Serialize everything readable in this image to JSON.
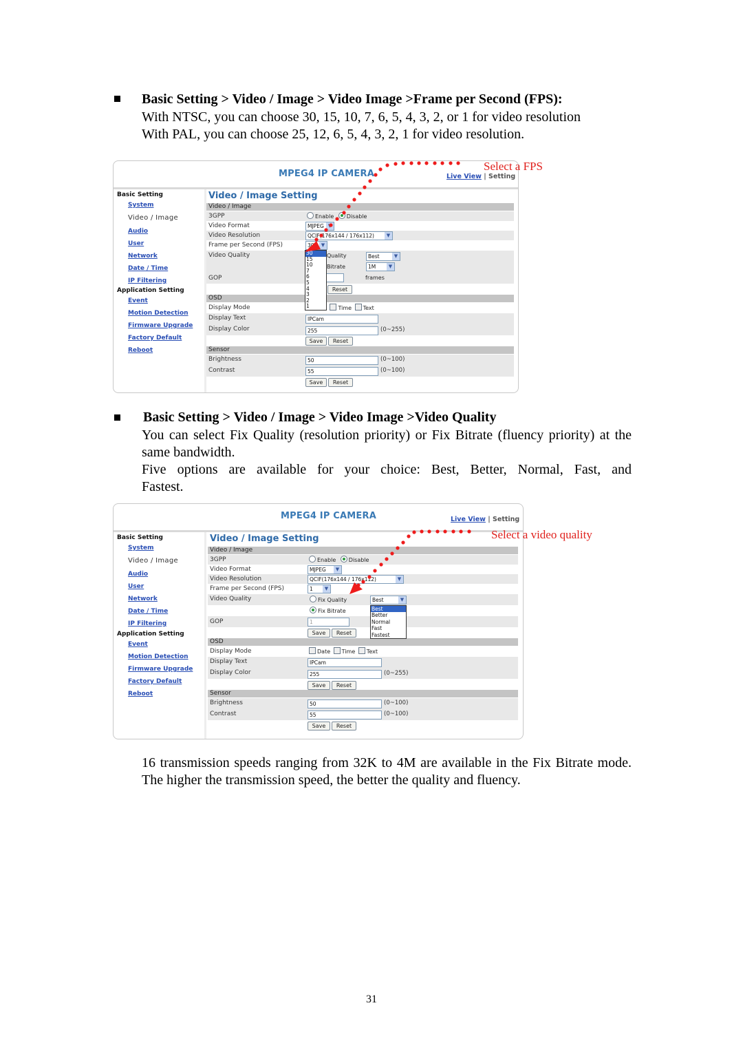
{
  "section1": {
    "heading": "Basic Setting > Video / Image > Video Image >Frame per Second (FPS):",
    "lines": [
      "With NTSC, you can choose 30, 15, 10, 7, 6, 5, 4, 3, 2, or 1 for video resolution",
      "With PAL, you can choose 25, 12, 6, 5, 4, 3, 2, 1 for video resolution."
    ],
    "annotation": "Select a FPS"
  },
  "section2": {
    "heading": "Basic Setting > Video / Image > Video Image >Video Quality",
    "paragraphs": [
      "You can select Fix Quality (resolution priority) or Fix Bitrate (fluency priority) at the same bandwidth.",
      "Five options are available for your choice: Best, Better, Normal, Fast, and Fastest."
    ],
    "annotation": "Select a video quality"
  },
  "section3": {
    "paragraph": "16 transmission speeds ranging from 32K to 4M are available in the Fix Bitrate mode. The higher the transmission speed, the better the quality and fluency."
  },
  "page_number": "31",
  "camera_ui": {
    "brand": "MPEG4 IP CAMERA",
    "nav_live_view": "Live View",
    "nav_sep": "|",
    "nav_setting": "Setting",
    "sidebar": {
      "basic_group": "Basic Setting",
      "basic_items": [
        "System",
        "Video / Image",
        "Audio",
        "User",
        "Network",
        "Date / Time",
        "IP Filtering"
      ],
      "app_group": "Application Setting",
      "app_items": [
        "Event",
        "Motion Detection",
        "Firmware Upgrade",
        "Factory Default",
        "Reboot"
      ]
    },
    "page_title": "Video / Image Setting",
    "labels": {
      "sec_video": "Video / Image",
      "gpp": "3GPP",
      "format": "Video Format",
      "resolution": "Video Resolution",
      "fps": "Frame per Second (FPS)",
      "quality": "Video Quality",
      "gop": "GOP",
      "sec_osd": "OSD",
      "display_mode": "Display Mode",
      "display_text": "Display Text",
      "display_color": "Display Color",
      "sec_sensor": "Sensor",
      "brightness": "Brightness",
      "contrast": "Contrast"
    },
    "enable": "Enable",
    "disable": "Disable",
    "format_value": "MJPEG",
    "resolution_value": "QCIF(176x144 / 176x112)",
    "fix_quality": "Fix Quality",
    "fix_bitrate": "Fix Bitrate",
    "frames": "frames",
    "date": "Date",
    "time": "Time",
    "text": "Text",
    "display_text_value": "IPCam",
    "display_color_value": "255",
    "color_range": "(0~255)",
    "brightness_value": "50",
    "contrast_value": "55",
    "sensor_range": "(0~100)",
    "save": "Save",
    "reset": "Reset"
  },
  "screenshot1": {
    "quality_partial": "Quality",
    "bitrate_partial": "Bitrate",
    "quality_select": "Best",
    "bitrate_select": "1M",
    "fps_options": [
      "30",
      "15",
      "10",
      "7",
      "6",
      "5",
      "4",
      "3",
      "2",
      "1"
    ],
    "fps_highlighted": "30",
    "mode_partial": "e"
  },
  "screenshot2": {
    "fps_value": "1",
    "quality_select": "Best",
    "quality_options": [
      "Best",
      "Better",
      "Normal",
      "Fast",
      "Fastest"
    ],
    "quality_highlighted": "Best",
    "gop_value": "1"
  }
}
